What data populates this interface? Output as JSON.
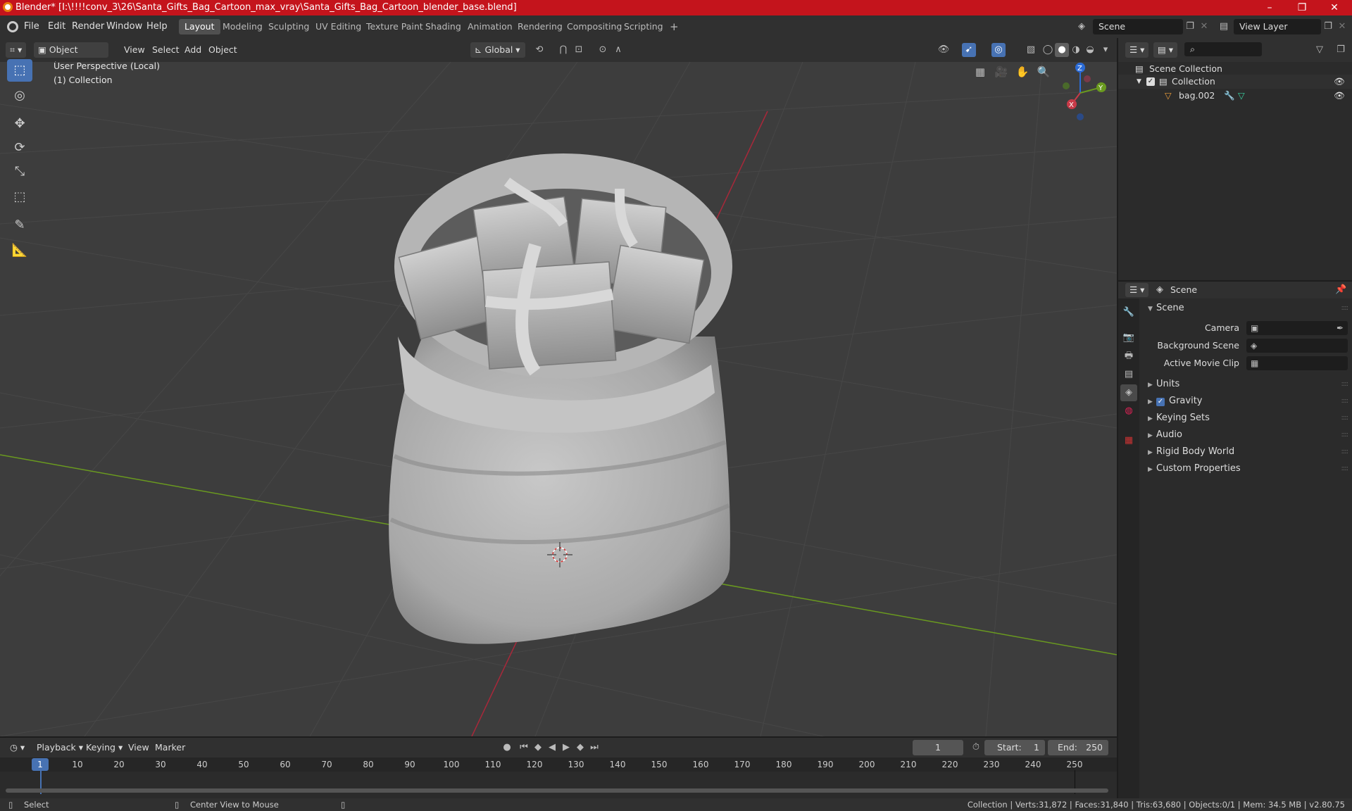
{
  "window": {
    "title": "Blender* [I:\\!!!!conv_3\\26\\Santa_Gifts_Bag_Cartoon_max_vray\\Santa_Gifts_Bag_Cartoon_blender_base.blend]",
    "minimize": "–",
    "maximize": "❐",
    "close": "✕"
  },
  "menus": [
    "File",
    "Edit",
    "Render",
    "Window",
    "Help"
  ],
  "workspaces": [
    "Layout",
    "Modeling",
    "Sculpting",
    "UV Editing",
    "Texture Paint",
    "Shading",
    "Animation",
    "Rendering",
    "Compositing",
    "Scripting"
  ],
  "workspace_add": "+",
  "scene_field": "Scene",
  "view_layer_field": "View Layer",
  "viewport_header": {
    "mode": "Object Mode",
    "view": "View",
    "select": "Select",
    "add": "Add",
    "object": "Object",
    "orientation": "Global"
  },
  "viewport": {
    "perspective": "User Perspective (Local)",
    "collection": "(1) Collection",
    "gizmo": {
      "x": "X",
      "y": "Y",
      "z": "Z"
    }
  },
  "outliner": {
    "scene_collection": "Scene Collection",
    "collection": "Collection",
    "object": "bag.002"
  },
  "properties": {
    "context": "Scene",
    "panel_title": "Scene",
    "camera_label": "Camera",
    "background_scene_label": "Background Scene",
    "active_movie_clip_label": "Active Movie Clip",
    "sections": [
      "Units",
      "Gravity",
      "Keying Sets",
      "Audio",
      "Rigid Body World",
      "Custom Properties"
    ]
  },
  "timeline": {
    "playback": "Playback",
    "keying": "Keying",
    "view": "View",
    "marker": "Marker",
    "current_frame": "1",
    "start_label": "Start:",
    "start": "1",
    "end_label": "End:",
    "end": "250",
    "ticks": [
      "10",
      "20",
      "30",
      "40",
      "50",
      "60",
      "70",
      "80",
      "90",
      "100",
      "110",
      "120",
      "130",
      "140",
      "150",
      "160",
      "170",
      "180",
      "190",
      "200",
      "210",
      "220",
      "230",
      "240",
      "250"
    ],
    "playhead": "1"
  },
  "statusbar": {
    "select": "Select",
    "center": "Center View to Mouse",
    "stats": "Collection | Verts:31,872 | Faces:31,840 | Tris:63,680 | Objects:0/1 | Mem: 34.5 MB | v2.80.75"
  },
  "colors": {
    "title_bar": "#c4141c",
    "accent": "#4772b3",
    "viewport_bg": "#3d3d3d",
    "x_axis": "#a8283a",
    "y_axis": "#6a9a1f"
  }
}
